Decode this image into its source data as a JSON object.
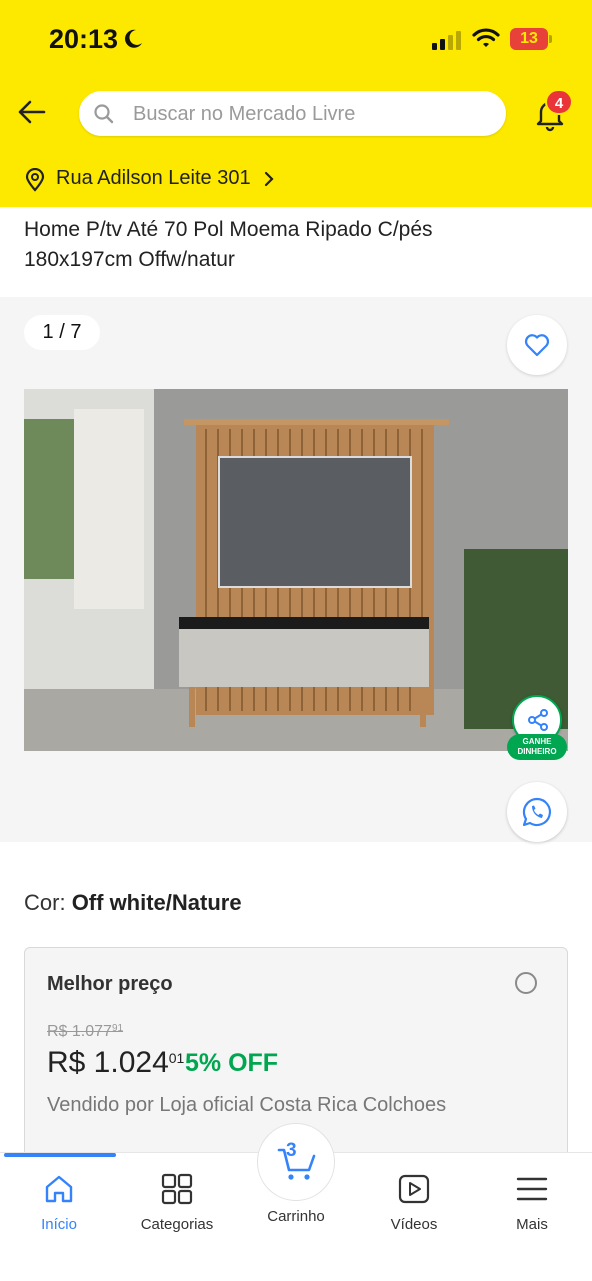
{
  "status_bar": {
    "time": "20:13",
    "battery": "13"
  },
  "header": {
    "search_placeholder": "Buscar no Mercado Livre",
    "notification_count": "4",
    "address": "Rua Adilson Leite 301",
    "brand_color": "#fde800"
  },
  "product": {
    "title": "Home P/tv Até 70 Pol Moema Ripado C/pés 180x197cm Offw/natur",
    "gallery_counter": "1 / 7",
    "earn_badge": "GANHE DINHEIRO",
    "color_label": "Cor:",
    "color_value": "Off white/Nature"
  },
  "offer": {
    "title": "Melhor preço",
    "old_price": "R$ 1.077",
    "old_price_cents": "91",
    "price": "R$ 1.024",
    "price_cents": "01",
    "discount": "5% OFF",
    "seller": "Vendido por Loja oficial Costa Rica Colchoes",
    "discount_color": "#00a650"
  },
  "tabbar": {
    "home": "Início",
    "categories": "Categorias",
    "cart": "Carrinho",
    "cart_count": "3",
    "videos": "Vídeos",
    "more": "Mais",
    "active_color": "#3483fa"
  }
}
